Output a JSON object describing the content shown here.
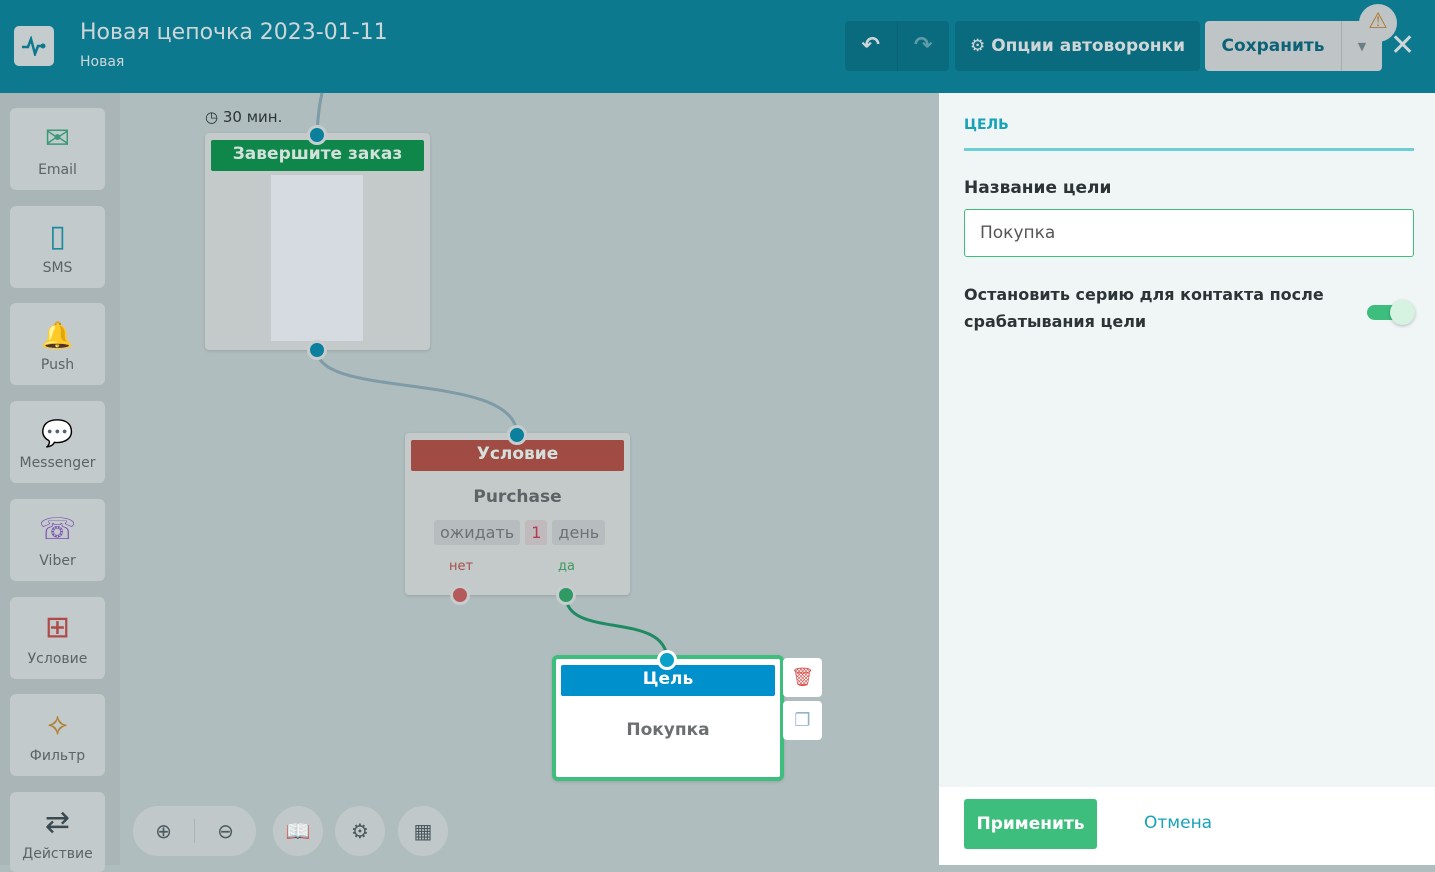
{
  "header": {
    "title": "Новая цепочка 2023-01-11",
    "status": "Новая",
    "undo": "↶",
    "redo": "↷",
    "options_label": "Опции автоворонки",
    "save_label": "Сохранить"
  },
  "sidebar": {
    "items": [
      {
        "label": "Email",
        "icon": "✉"
      },
      {
        "label": "SMS",
        "icon": "▯"
      },
      {
        "label": "Push",
        "icon": "🔔"
      },
      {
        "label": "Messenger",
        "icon": "💬"
      },
      {
        "label": "Viber",
        "icon": "☏"
      },
      {
        "label": "Условие",
        "icon": "⊞"
      },
      {
        "label": "Фильтр",
        "icon": "⟡"
      },
      {
        "label": "Действие",
        "icon": "⇄"
      }
    ]
  },
  "canvas": {
    "delay": "30 мин.",
    "email_node": {
      "title": "Завершите заказ"
    },
    "condition_node": {
      "title": "Условие",
      "event": "Purchase",
      "wait_label": "ожидать",
      "wait_value": "1",
      "wait_unit": "день",
      "no": "нет",
      "yes": "да"
    },
    "goal_node": {
      "title": "Цель",
      "name": "Покупка"
    },
    "colors": {
      "email": "#0f874a",
      "condition": "#a04b43",
      "goal": "#0090cc",
      "selected": "#3dbe7c"
    }
  },
  "panel": {
    "section": "ЦЕЛЬ",
    "name_label": "Название цели",
    "name_value": "Покупка",
    "stop_label": "Остановить серию для контакта после срабатывания цели",
    "stop_enabled": true,
    "apply": "Применить",
    "cancel": "Отмена"
  }
}
